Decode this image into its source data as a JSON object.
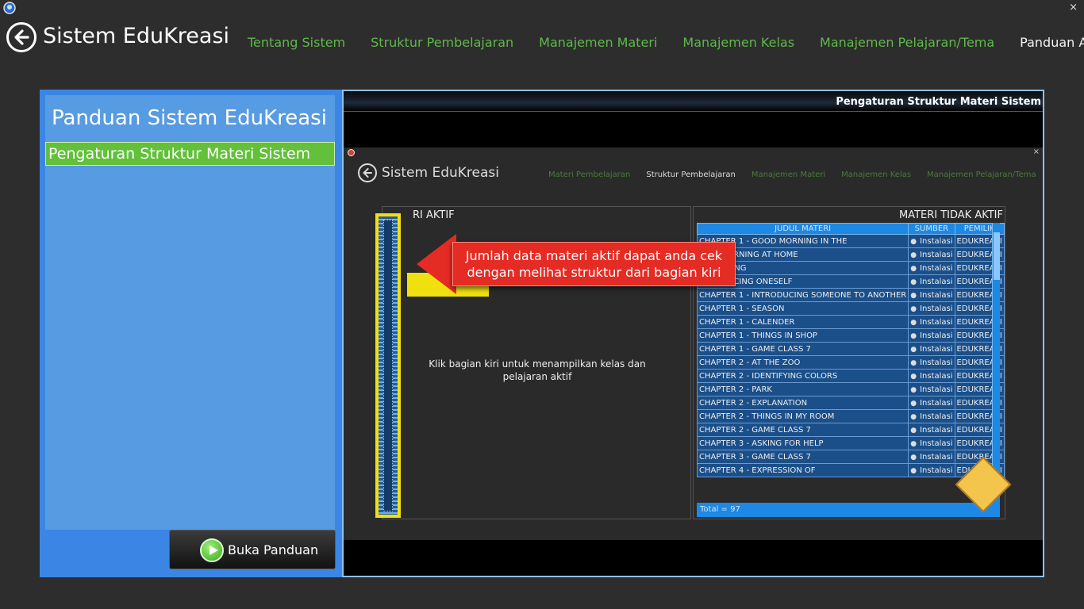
{
  "app": {
    "title": "Sistem EduKreasi",
    "close_glyph": "×"
  },
  "nav": [
    {
      "label": "Tentang Sistem"
    },
    {
      "label": "Struktur Pembelajaran"
    },
    {
      "label": "Manajemen Materi"
    },
    {
      "label": "Manajemen Kelas"
    },
    {
      "label": "Manajemen Pelajaran/Tema"
    },
    {
      "label": "Panduan Aplikasi"
    }
  ],
  "guide": {
    "title": "Panduan Sistem EduKreasi",
    "items": [
      {
        "label": "Pengaturan Struktur Materi Sistem"
      }
    ],
    "open_button": "Buka Panduan"
  },
  "preview": {
    "caption": "Pengaturan Struktur Materi Sistem",
    "screen": {
      "title": "Sistem EduKreasi",
      "nav": [
        {
          "label": "Materi Pembelajaran"
        },
        {
          "label": "Struktur Pembelajaran"
        },
        {
          "label": "Manajemen Materi"
        },
        {
          "label": "Manajemen Kelas"
        },
        {
          "label": "Manajemen Pelajaran/Tema"
        }
      ],
      "active_title": "RI AKTIF",
      "hint": "Klik bagian kiri untuk menampilkan kelas dan pelajaran aktif",
      "callout": "Jumlah data materi aktif dapat anda cek dengan melihat struktur dari bagian kiri",
      "inactive_title": "MATERI TIDAK AKTIF",
      "table": {
        "headers": [
          "JUDUL MATERI",
          "SUMBER",
          "PEMILIK"
        ],
        "rows": [
          [
            "CHAPTER 1 - GOOD MORNING IN THE",
            "Instalasi",
            "EDUKREASI"
          ],
          [
            "OOD MORNING AT HOME",
            "Instalasi",
            "EDUKREASI"
          ],
          [
            "AVE TAKING",
            "Instalasi",
            "EDUKREASI"
          ],
          [
            "NTRODUCING ONESELF",
            "Instalasi",
            "EDUKREASI"
          ],
          [
            "CHAPTER 1 - INTRODUCING SOMEONE TO ANOTHER",
            "Instalasi",
            "EDUKREASI"
          ],
          [
            "CHAPTER 1 - SEASON",
            "Instalasi",
            "EDUKREASI"
          ],
          [
            "CHAPTER 1 - CALENDER",
            "Instalasi",
            "EDUKREASI"
          ],
          [
            "CHAPTER 1 - THINGS IN SHOP",
            "Instalasi",
            "EDUKREASI"
          ],
          [
            "CHAPTER 1 - GAME CLASS 7",
            "Instalasi",
            "EDUKREASI"
          ],
          [
            "CHAPTER 2 - AT THE ZOO",
            "Instalasi",
            "EDUKREASI"
          ],
          [
            "CHAPTER 2 - IDENTIFYING COLORS",
            "Instalasi",
            "EDUKREASI"
          ],
          [
            "CHAPTER 2 - PARK",
            "Instalasi",
            "EDUKREASI"
          ],
          [
            "CHAPTER 2 - EXPLANATION",
            "Instalasi",
            "EDUKREASI"
          ],
          [
            "CHAPTER 2 - THINGS IN MY ROOM",
            "Instalasi",
            "EDUKREASI"
          ],
          [
            "CHAPTER 2 - GAME CLASS 7",
            "Instalasi",
            "EDUKREASI"
          ],
          [
            "CHAPTER 3 - ASKING FOR HELP",
            "Instalasi",
            "EDUKREASI"
          ],
          [
            "CHAPTER 3 - GAME CLASS 7",
            "Instalasi",
            "EDUKREASI"
          ],
          [
            "CHAPTER 4 - EXPRESSION OF",
            "Instalasi",
            "EDUKREASI"
          ]
        ],
        "footer": "Total = 97"
      }
    }
  },
  "colors": {
    "accent_green": "#5fb84a",
    "panel_blue": "#3b86e4",
    "callout_red": "#e42b24",
    "highlight_yellow": "#f0e010"
  }
}
